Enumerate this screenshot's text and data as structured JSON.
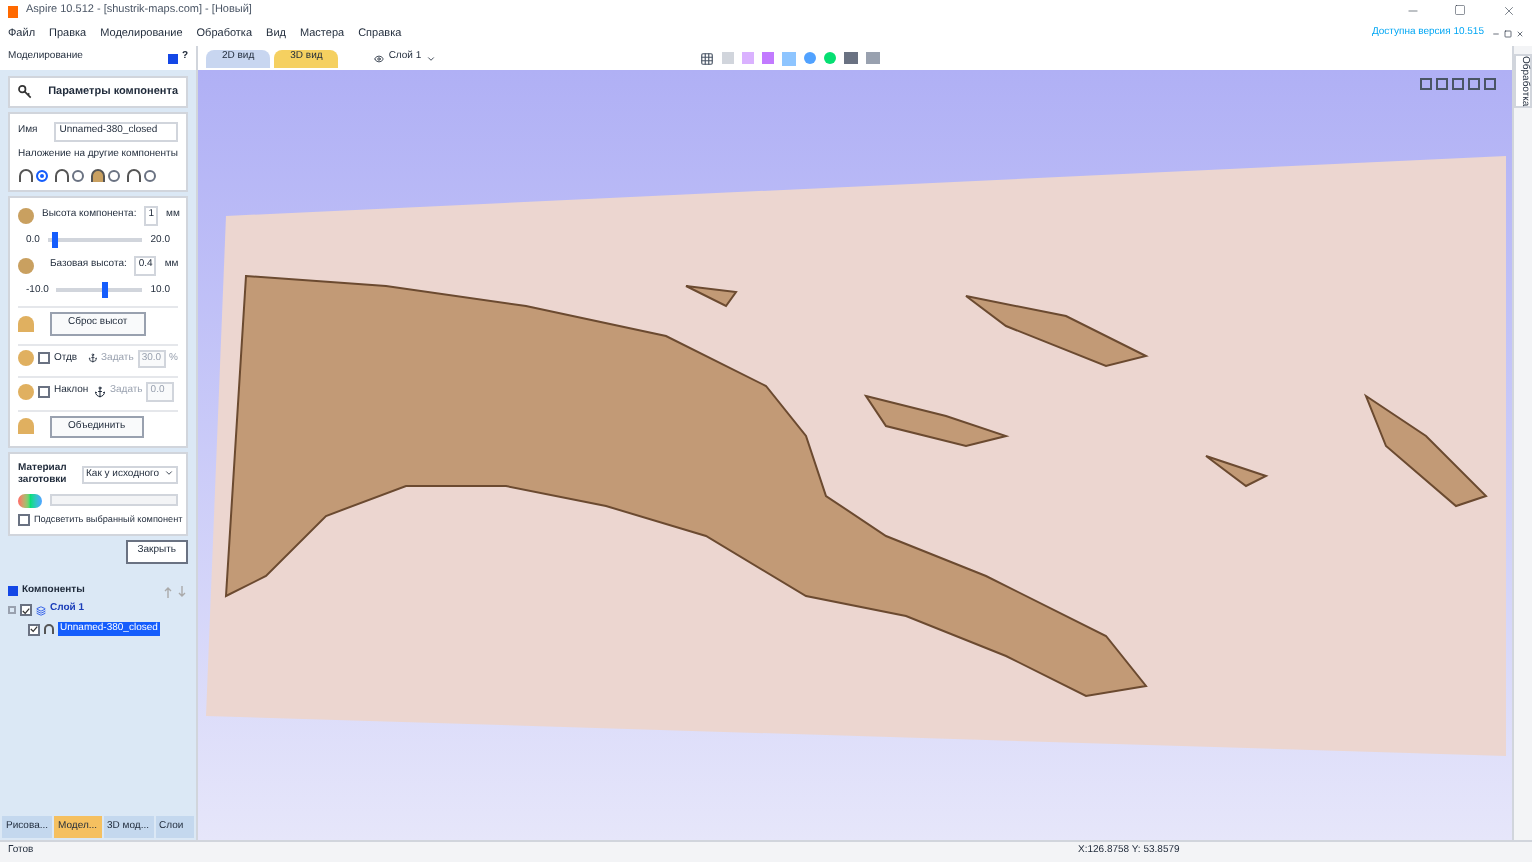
{
  "window": {
    "title": "Aspire 10.512 - [shustrik-maps.com] - [Новый]"
  },
  "menu": [
    "Файл",
    "Правка",
    "Моделирование",
    "Обработка",
    "Вид",
    "Мастера",
    "Справка"
  ],
  "update_notice": "Доступна версия 10.515",
  "panel": {
    "title": "Моделирование",
    "help": "?"
  },
  "view_tabs": [
    {
      "label": "2D вид",
      "selected": false
    },
    {
      "label": "3D вид",
      "selected": true
    }
  ],
  "layer_select": "Слой 1",
  "right_tab": "Обработка",
  "params": {
    "heading": "Параметры компонента",
    "name_label": "Имя",
    "name_value": "Unnamed-380_closed",
    "blend_label": "Наложение на другие компоненты",
    "blend_modes": [
      {
        "selected": true
      },
      {
        "selected": false
      },
      {
        "selected": false
      },
      {
        "selected": false
      }
    ],
    "height": {
      "label": "Высота компонента:",
      "value": "1",
      "unit": "мм",
      "min": "0.0",
      "max": "20.0",
      "level": 0.05
    },
    "base": {
      "label": "Базовая высота:",
      "value": "0.4",
      "unit": "мм",
      "min": "-10.0",
      "max": "10.0",
      "level": 0.52
    },
    "reset": "Сброс высот",
    "options": [
      {
        "label": "Отдв",
        "checked": false,
        "disabled": true,
        "action": "Задать",
        "value": "30.0",
        "unit": "%"
      },
      {
        "label": "Наклон",
        "checked": false,
        "disabled": true,
        "action": "Задать",
        "value": "0.0"
      }
    ],
    "merge": "Объединить",
    "material_label": "Материал заготовки",
    "material_value": "Как у исходного",
    "highlight": {
      "label": "Подсветить выбранный компонент",
      "checked": false
    },
    "close": "Закрыть"
  },
  "components": {
    "title": "Компоненты",
    "tree": [
      {
        "label": "Слой 1",
        "checked": true,
        "children": [
          {
            "label": "Unnamed-380_closed",
            "checked": true,
            "selected": true
          }
        ]
      }
    ]
  },
  "bottom_tabs": [
    {
      "label": "Рисова...",
      "selected": false
    },
    {
      "label": "Модел...",
      "selected": true
    },
    {
      "label": "3D мод...",
      "selected": false
    },
    {
      "label": "Слои",
      "selected": false
    }
  ],
  "status_bar": {
    "state": "Готов",
    "coords": "X:126.8758 Y: 53.8579"
  }
}
